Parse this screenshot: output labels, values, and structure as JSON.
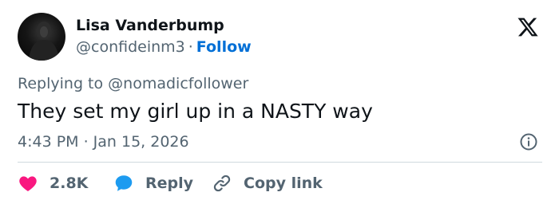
{
  "author": {
    "name": "Lisa Vanderbump",
    "handle": "@confideinm3",
    "separator": "·",
    "follow_label": "Follow"
  },
  "reply_context": {
    "prefix": "Replying to",
    "mention": "@nomadicfollower"
  },
  "tweet": {
    "text": "They set my girl up in a NASTY way",
    "timestamp": "4:43 PM · Jan 15, 2026"
  },
  "actions": {
    "like_count": "2.8K",
    "reply_label": "Reply",
    "copy_link_label": "Copy link"
  },
  "colors": {
    "like": "#f91880",
    "reply": "#1d9bf0",
    "link": "#006fd6",
    "secondary_text": "#536471",
    "primary_text": "#0f1419"
  },
  "icons": [
    "x-logo-icon",
    "info-icon",
    "heart-icon",
    "reply-bubble-icon",
    "link-icon"
  ]
}
